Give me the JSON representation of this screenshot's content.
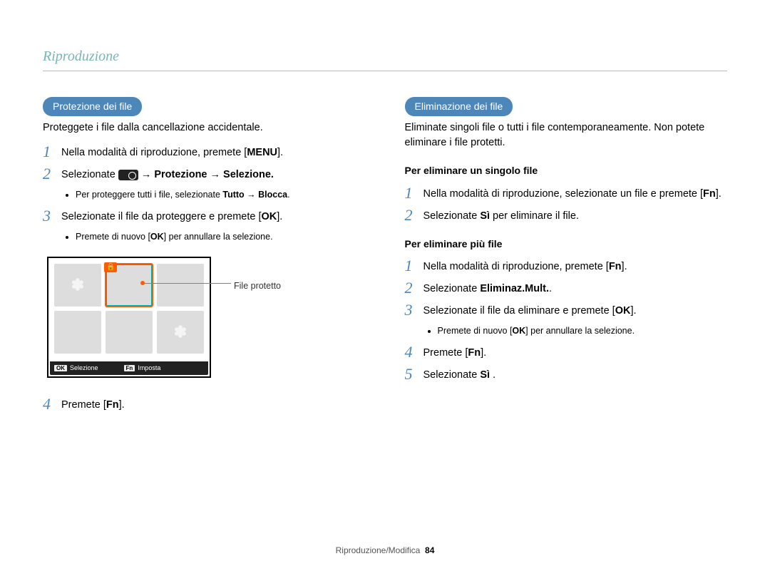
{
  "header": {
    "title": "Riproduzione"
  },
  "footer": {
    "section": "Riproduzione/Modifica",
    "page": "84"
  },
  "left": {
    "pill": "Protezione dei file",
    "subtitle": "Proteggete i file dalla cancellazione accidentale.",
    "steps": {
      "s1": {
        "num": "1",
        "pre": "Nella modalità di riproduzione, premete [",
        "key": "MENU",
        "post": "]."
      },
      "s2": {
        "num": "2",
        "pre": "Selezionate ",
        "suffix": " → Protezione → Selezione."
      },
      "s2_bullet": {
        "pre": "Per proteggere tutti i file, selezionate ",
        "bold1": "Tutto",
        "mid": " → ",
        "bold2": "Blocca",
        "post": "."
      },
      "s3": {
        "num": "3",
        "pre": "Selezionate il file da proteggere e premete [",
        "key": "OK",
        "post": "]."
      },
      "s3_bullet": {
        "pre": "Premete di nuovo [",
        "key": "OK",
        "post": "] per annullare la selezione."
      },
      "s4": {
        "num": "4",
        "pre": "Premete [",
        "key": "Fn",
        "post": "]."
      }
    },
    "screenshot": {
      "callout": "File protetto",
      "bar_ok_key": "OK",
      "bar_ok_label": "Selezione",
      "bar_fn_key": "Fn",
      "bar_fn_label": "Imposta"
    }
  },
  "right": {
    "pill": "Eliminazione dei file",
    "subtitle": "Eliminate singoli file o tutti i file contemporaneamente. Non potete eliminare i file protetti.",
    "sub1_title": "Per eliminare un singolo file",
    "sub1": {
      "s1": {
        "num": "1",
        "pre": "Nella modalità di riproduzione, selezionate un file e premete [",
        "key": "Fn",
        "post": "]."
      },
      "s2": {
        "num": "2",
        "pre": "Selezionate ",
        "bold": "Sì",
        "post": " per eliminare il file."
      }
    },
    "sub2_title": "Per eliminare più file",
    "sub2": {
      "s1": {
        "num": "1",
        "pre": "Nella modalità di riproduzione, premete [",
        "key": "Fn",
        "post": "]."
      },
      "s2": {
        "num": "2",
        "pre": "Selezionate ",
        "bold": "Eliminaz.Mult.",
        "post": "."
      },
      "s3": {
        "num": "3",
        "pre": "Selezionate il file da eliminare e premete [",
        "key": "OK",
        "post": "]."
      },
      "s3_bullet": {
        "pre": "Premete di nuovo [",
        "key": "OK",
        "post": "] per annullare la selezione."
      },
      "s4": {
        "num": "4",
        "pre": "Premete [",
        "key": "Fn",
        "post": "]."
      },
      "s5": {
        "num": "5",
        "pre": "Selezionate ",
        "bold": "Sì",
        "post": " ."
      }
    }
  }
}
